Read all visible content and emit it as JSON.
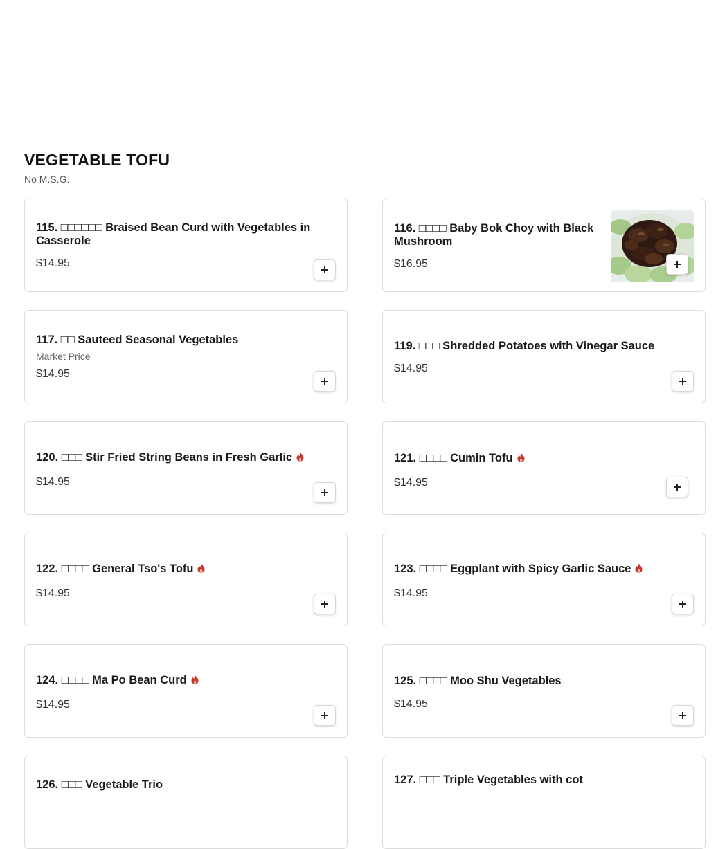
{
  "section": {
    "title": "VEGETABLE TOFU",
    "subtitle": "No M.S.G."
  },
  "items": [
    {
      "name": "115. □□□□□□ Braised Bean Curd with Vegetables in Casserole",
      "price": "$14.95"
    },
    {
      "name": "116. □□□□ Baby Bok Choy with Black Mushroom",
      "price": "$16.95",
      "image": "bok-choy-black-mushroom-photo"
    },
    {
      "name": "117. □□ Sauteed Seasonal Vegetables",
      "note": "Market Price",
      "price": "$14.95"
    },
    {
      "name": "119. □□□ Shredded Potatoes with Vinegar Sauce",
      "price": "$14.95"
    },
    {
      "name": "120. □□□ Stir Fried String Beans in Fresh Garlic",
      "price": "$14.95",
      "spicy": true
    },
    {
      "name": "121. □□□□ Cumin Tofu",
      "price": "$14.95",
      "spicy": true
    },
    {
      "name": "122. □□□□ General Tso's Tofu",
      "price": "$14.95",
      "spicy": true
    },
    {
      "name": "123. □□□□ Eggplant with Spicy Garlic Sauce",
      "price": "$14.95",
      "spicy": true
    },
    {
      "name": "124. □□□□ Ma Po Bean Curd",
      "price": "$14.95",
      "spicy": true
    },
    {
      "name": "125. □□□□ Moo Shu Vegetables",
      "price": "$14.95"
    },
    {
      "name": "126. □□□ Vegetable Trio"
    },
    {
      "name": "127. □□□ Triple Vegetables with cot"
    }
  ],
  "icons": {
    "add": "plus-icon",
    "spicy": "chili-flame-icon"
  },
  "colors": {
    "spicy": "#c0392b",
    "border": "#dcdcdc",
    "text": "#1b1b1b"
  }
}
